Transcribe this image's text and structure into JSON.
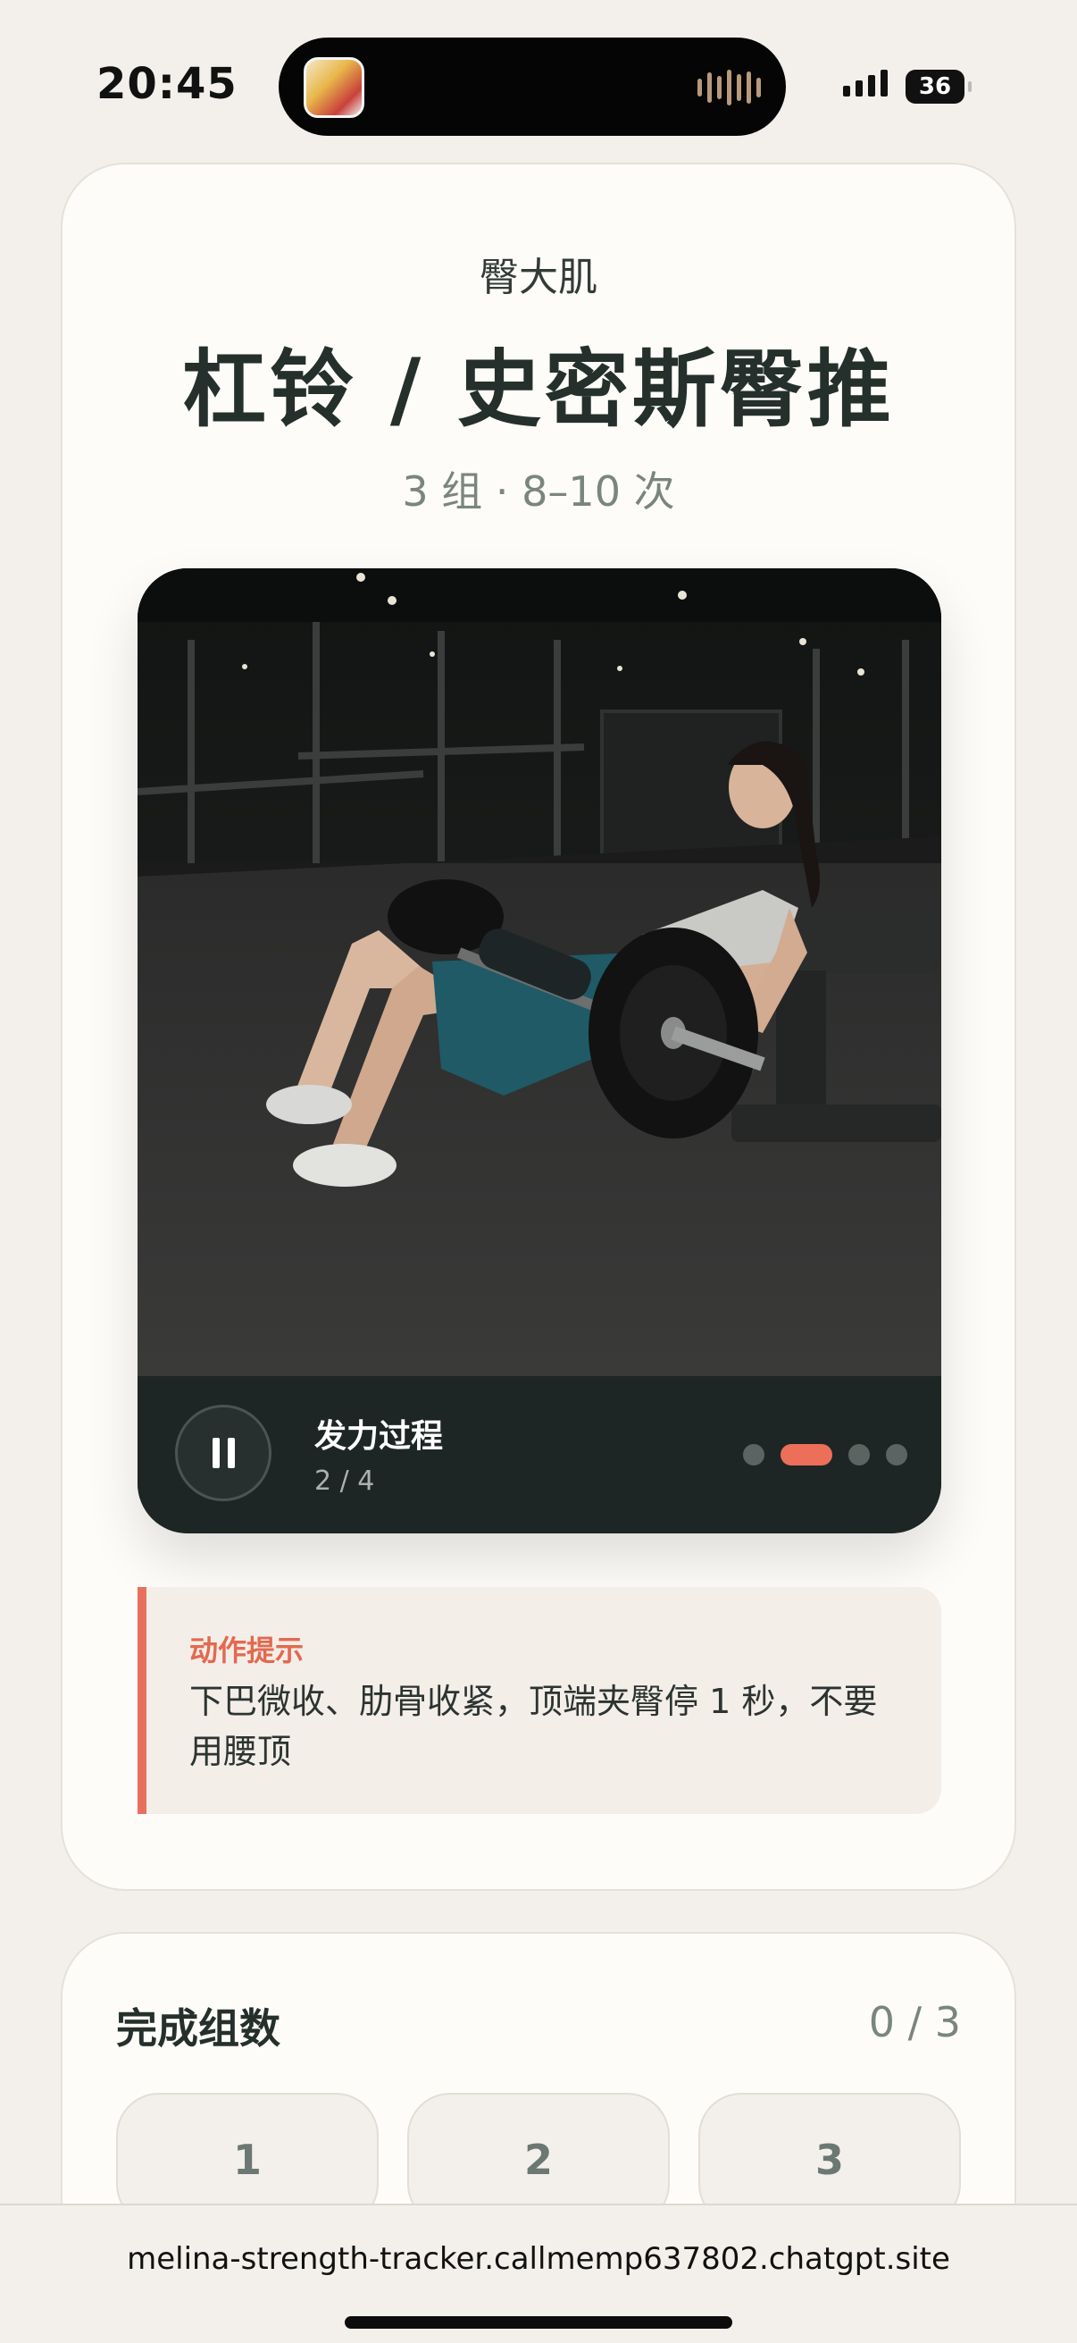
{
  "status_bar": {
    "time": "20:45",
    "battery": "36"
  },
  "exercise": {
    "muscle_group": "臀大肌",
    "name": "杠铃 / 史密斯臀推",
    "prescription": "3 组 · 8–10 次",
    "media": {
      "phase_title": "发力过程",
      "phase_count": "2 / 4",
      "steps_total": 4,
      "active_step": 2,
      "playing": true
    },
    "tip": {
      "label": "动作提示",
      "text": "下巴微收、肋骨收紧，顶端夹臀停 1 秒，不要用腰顶"
    }
  },
  "sets": {
    "label": "完成组数",
    "progress": "0 / 3",
    "buttons": [
      "1",
      "2",
      "3"
    ]
  },
  "browser": {
    "url": "melina-strength-tracker.callmemp637802.chatgpt.site"
  },
  "colors": {
    "accent": "#ec6f59",
    "background": "#f3f0eb",
    "card": "#fdfcf8",
    "dark_panel": "#1d2624"
  }
}
